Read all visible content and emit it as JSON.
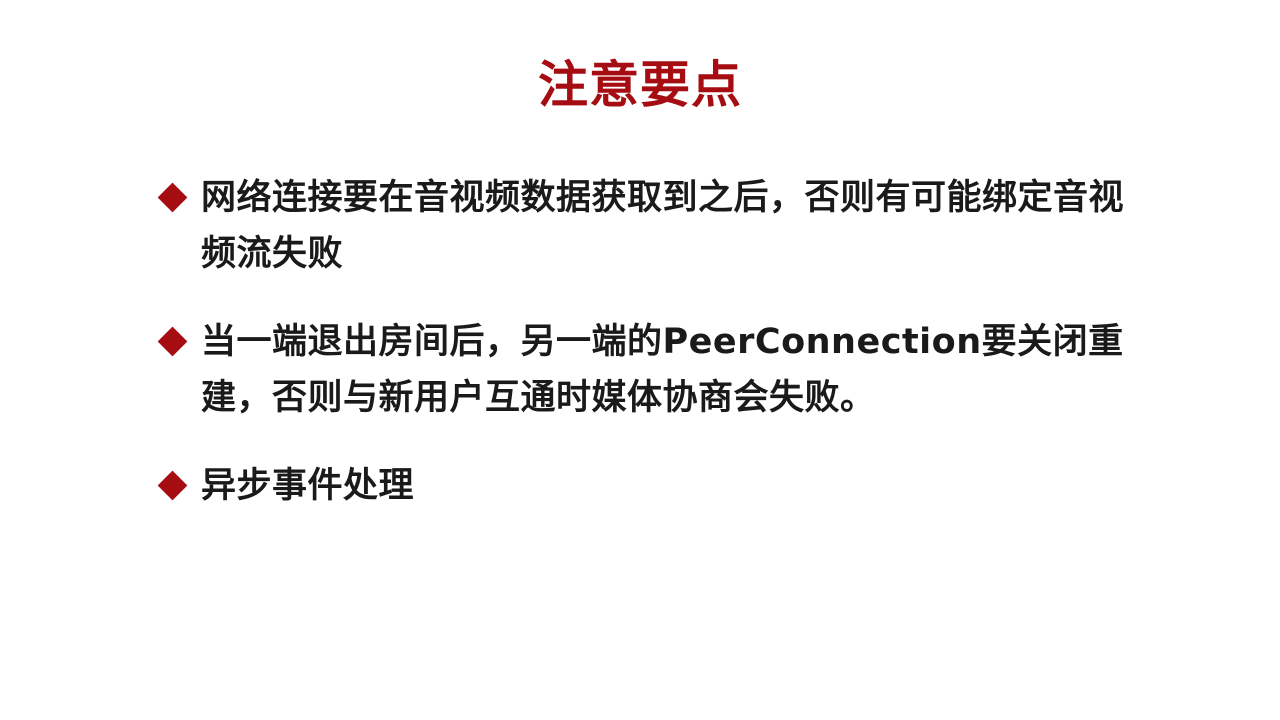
{
  "slide": {
    "title": "注意要点",
    "colors": {
      "accent": "#a50d12",
      "text": "#1a1a1a",
      "background": "#ffffff"
    },
    "bullets": [
      {
        "marker_icon": "diamond-bullet-icon",
        "text": "网络连接要在音视频数据获取到之后，否则有可能绑定音视频流失败"
      },
      {
        "marker_icon": "diamond-bullet-icon",
        "text": "当一端退出房间后，另一端的PeerConnection要关闭重建，否则与新用户互通时媒体协商会失败。"
      },
      {
        "marker_icon": "diamond-bullet-icon",
        "text": "异步事件处理"
      }
    ]
  }
}
